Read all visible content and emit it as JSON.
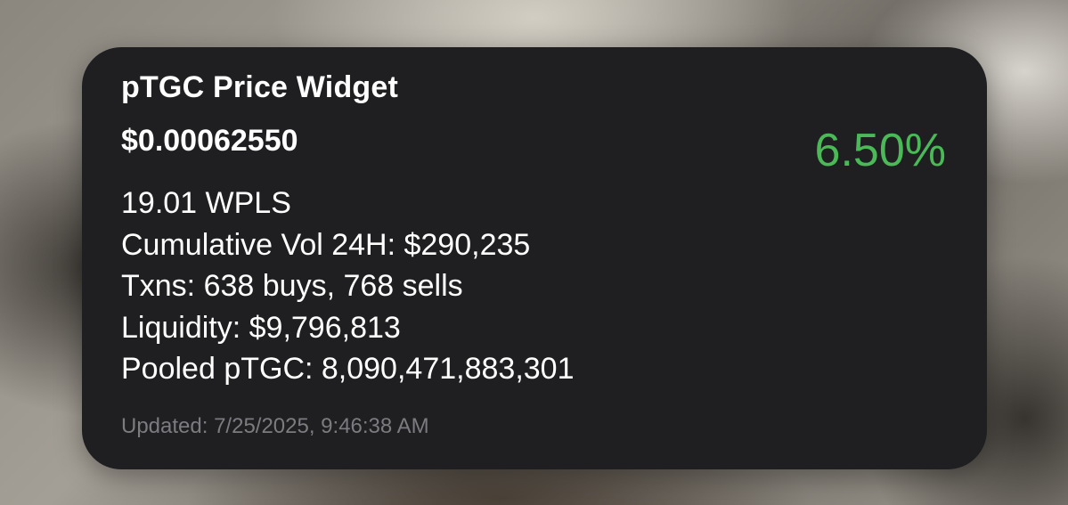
{
  "widget": {
    "title": "pTGC Price Widget",
    "price": "$0.00062550",
    "change_percent": "6.50%",
    "stats": {
      "wpls": "19.01 WPLS",
      "volume": "Cumulative Vol 24H: $290,235",
      "txns": "Txns: 638 buys, 768 sells",
      "liquidity": "Liquidity: $9,796,813",
      "pooled": "Pooled pTGC: 8,090,471,883,301"
    },
    "updated": "Updated: 7/25/2025, 9:46:38 AM"
  },
  "colors": {
    "widget_background": "#1f1f21",
    "positive_change": "#4cb958",
    "muted_text": "#7b7b80",
    "primary_text": "#ffffff"
  }
}
